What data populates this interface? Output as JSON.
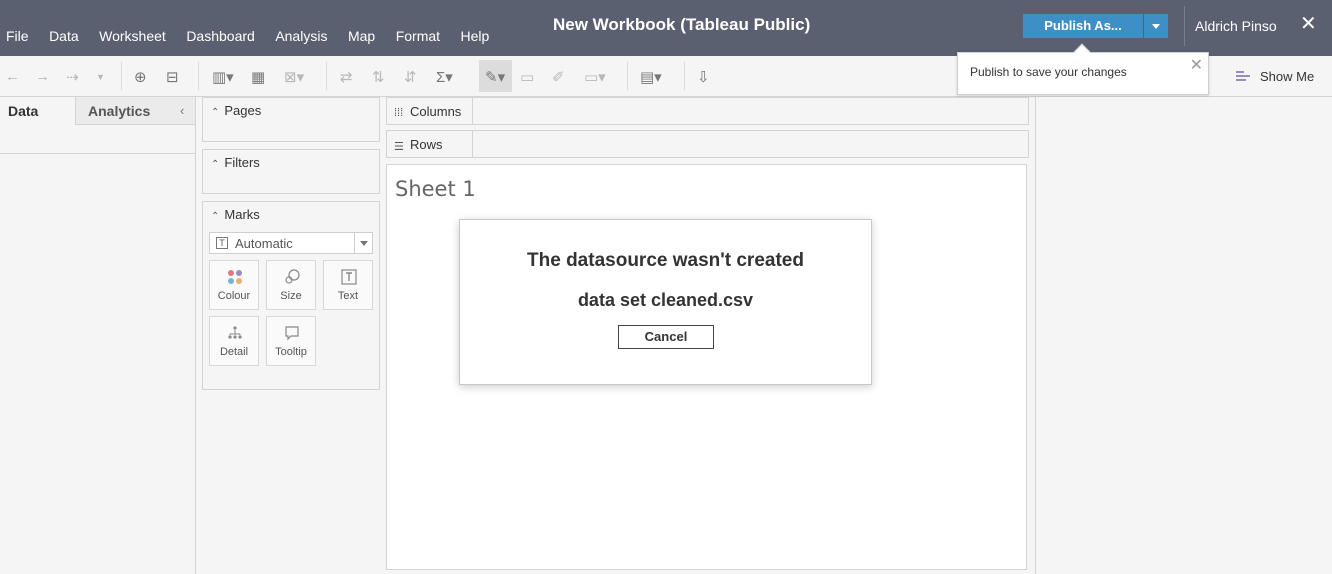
{
  "menu": [
    "File",
    "Data",
    "Worksheet",
    "Dashboard",
    "Analysis",
    "Map",
    "Format",
    "Help"
  ],
  "title": "New Workbook (Tableau Public)",
  "publish": {
    "label": "Publish As..."
  },
  "user": "Aldrich Pinso",
  "publish_popup": {
    "message": "Publish to save your changes"
  },
  "toolbar": {
    "show_me": "Show Me"
  },
  "data_pane": {
    "tab_data": "Data",
    "tab_analytics": "Analytics"
  },
  "cards": {
    "pages": "Pages",
    "filters": "Filters",
    "marks": "Marks"
  },
  "marks": {
    "type": "Automatic",
    "buttons": [
      "Colour",
      "Size",
      "Text",
      "Detail",
      "Tooltip"
    ]
  },
  "shelves": {
    "columns": "Columns",
    "rows": "Rows"
  },
  "sheet": {
    "title": "Sheet 1"
  },
  "dialog": {
    "message": "The datasource wasn't created",
    "filename": "data set cleaned.csv",
    "cancel": "Cancel"
  },
  "colors": {
    "header_bg": "#5b6070",
    "publish_blue": "#3e8fc5"
  }
}
